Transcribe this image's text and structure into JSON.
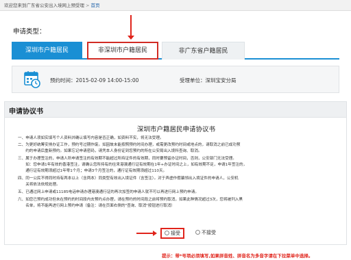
{
  "breadcrumb": {
    "welcome": "欢迎您来到广东省公安出入境网上预受理",
    "separator": ">",
    "home": "首页"
  },
  "apply_type_label": "申请类型：",
  "tabs": [
    {
      "label": "深圳市户籍居民",
      "active": true
    },
    {
      "label": "非深圳市户籍居民",
      "active": false,
      "highlighted": true
    },
    {
      "label": "非广东省户籍居民",
      "active": false
    }
  ],
  "appointment": {
    "time_label": "预约时间：",
    "time_value": "2015-02-09 14:00-15:00",
    "unit_label": "受理单位：",
    "unit_value": "深圳宝安分局"
  },
  "agreement": {
    "section_title": "申请协议书",
    "doc_title": "深圳市户籍居民申请协议书",
    "clauses": [
      "一、申请人须如实填写个人资料并确认填写内容是否正确，如资料不实，将无法受理。",
      "二、为更好统筹安排办证工作，预约号过期作废。如因故未能按照预约时间办理，或需更改预约时间或地点的，请取消之前已成功预",
      "　　约的申请后重新预约。如果忘记申请密码，请凭本人身份证到您预约的所在公安局出入境科查询、取消。",
      "三、属于办理签注的，申请人所申请签注的有效期不能超过所持证件的有效期，同时要预留办证时间，否则，公安部门无法受理。",
      "　　如：您申请1年有效的香港签注，请确认您所持有的往来港澳通行证有效期在1年+办证时间之上，如有效期不足，申请1年签注的，",
      "　　通行证有效期须超过1年零1个月；申请3个月签注的，通行证有效期须超过110天。",
      "四、同一公民不得同时持有两本以上（含两本）同类型有效出入境证件（含签注）。对于弄虚作假骗领出入境证件的申请人，公安机",
      "　　关将依法依规处理。",
      "五、已通过网上申请或11185电话申请办理港澳通行证的再次加签的申请人就不可以再进行网上预约申请。",
      "六、如您已预约成功但未在预约的时间段内去预约点办理，请在预约的时间段之前将预约取消，如果此种情况超过3次，您将被列入黑",
      "　　名单，将不能再进行网上预约申请（备注：请在页面右侧的\"查询、取消\"按钮进行取消）"
    ],
    "accept_label": "接受",
    "reject_label": "不接受"
  },
  "footer_tip": "提示：带*号项必须填写,如果拼音姓、拼音名为多音字请在下拉菜单中选择。",
  "colors": {
    "accent_blue": "#1a8fd4",
    "highlight_red": "#e0241b"
  }
}
